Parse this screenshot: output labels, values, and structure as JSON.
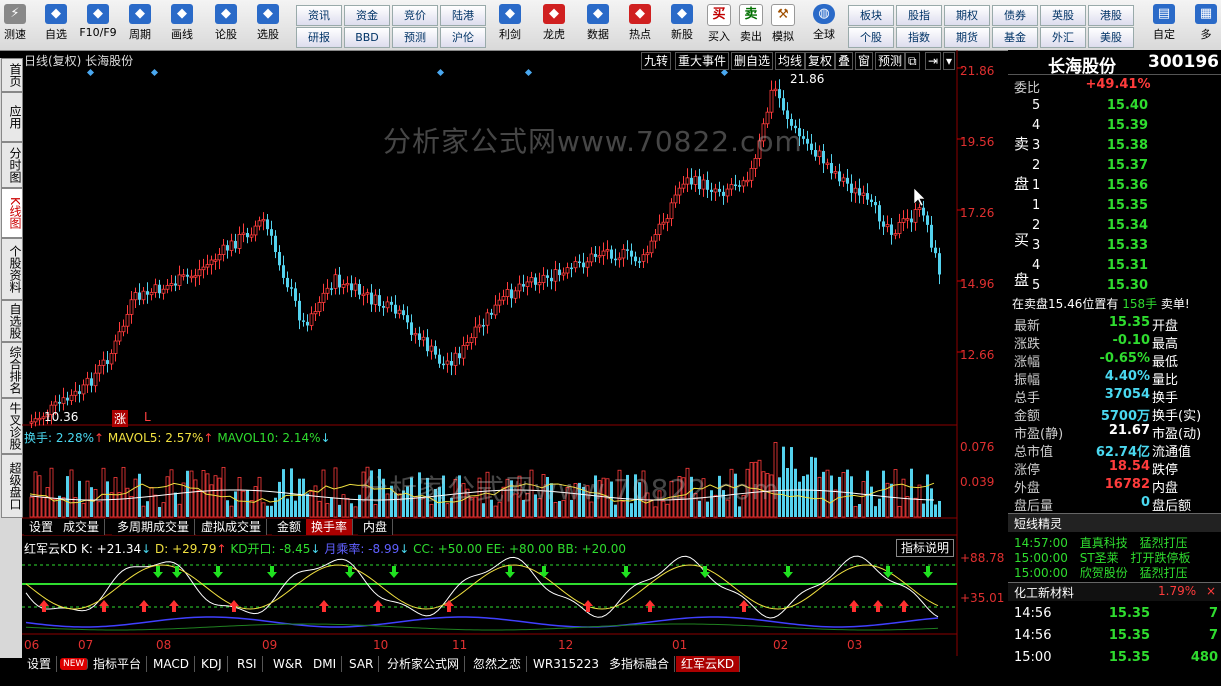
{
  "toolbar": {
    "left_label": "测速",
    "items": [
      {
        "label": "自选",
        "icon": "star-icon",
        "color": "#2a6ac8"
      },
      {
        "label": "F10/F9",
        "icon": "document-icon",
        "color": "#2a6ac8"
      },
      {
        "label": "周期",
        "icon": "clock-icon",
        "color": "#2a6ac8"
      },
      {
        "label": "画线",
        "icon": "pen-icon",
        "color": "#2a6ac8"
      },
      {
        "label": "论股",
        "icon": "forum-icon",
        "color": "#2a6ac8"
      },
      {
        "label": "选股",
        "icon": "speedometer-icon",
        "color": "#2a6ac8"
      }
    ],
    "grid1": [
      [
        "资讯",
        "研报"
      ],
      [
        "资金",
        "BBD"
      ],
      [
        "竞价",
        "预测"
      ],
      [
        "陆港",
        "沪伦"
      ]
    ],
    "items2": [
      {
        "label": "利剑",
        "icon": "chart-icon",
        "color": "#2a6ac8"
      },
      {
        "label": "龙虎",
        "icon": "dragon-icon",
        "color": "#d02020"
      },
      {
        "label": "数据",
        "icon": "pe-icon",
        "color": "#2a6ac8"
      },
      {
        "label": "热点",
        "icon": "fire-icon",
        "color": "#d02020"
      },
      {
        "label": "新股",
        "icon": "ipo-icon",
        "color": "#2a6ac8"
      }
    ],
    "trade": [
      {
        "label": "买入",
        "glyph": "买",
        "color": "#c00000"
      },
      {
        "label": "卖出",
        "glyph": "卖",
        "color": "#007000"
      },
      {
        "label": "模拟",
        "glyph": "⚒",
        "color": "#a05000"
      }
    ],
    "globe_label": "全球",
    "grid2": [
      [
        "板块",
        "个股"
      ],
      [
        "股指",
        "指数"
      ],
      [
        "期权",
        "期货"
      ],
      [
        "债券",
        "基金"
      ],
      [
        "英股",
        "外汇"
      ],
      [
        "港股",
        "美股"
      ]
    ],
    "custom_label": "自定",
    "more_label": "多"
  },
  "lefttabs": [
    "首页",
    "应用",
    "分时图",
    "K线图",
    "个股资料",
    "自选股",
    "综合排名",
    "牛叉诊股",
    "超级盘口"
  ],
  "chart": {
    "header_left": "日线(复权)  长海股份",
    "top_buttons": [
      "九转",
      "重大事件",
      "删自选",
      "均线",
      "复权",
      "叠",
      "窗",
      "预测"
    ],
    "watermark": "分析家公式网www.70822.com",
    "price_ticks": [
      "21.86",
      "19.56",
      "17.26",
      "14.96",
      "12.66"
    ],
    "high_label": "21.86",
    "low_label": "10.36",
    "zhang_label": "涨",
    "l_label": "L",
    "vol_header": {
      "hs": "换手: 2.28%",
      "mv5": "MAVOL5: 2.57%",
      "mv10": "MAVOL10: 2.14%"
    },
    "vol_ticks": [
      "0.076",
      "0.039"
    ],
    "mid_tabs": [
      "设置",
      "成交量",
      "多周期成交量",
      "虚拟成交量",
      "金额",
      "换手率",
      "内盘"
    ],
    "kd_header": {
      "name": "红军云KD",
      "k": "K: +21.34",
      "d": "D: +29.79",
      "kdo": "KD开口: -8.45",
      "yjl": "月乘率: -8.99",
      "cc": "CC: +50.00",
      "ee": "EE: +80.00",
      "bb": "BB: +20.00"
    },
    "kd_button": "指标说明",
    "kd_ticks": [
      "+88.78",
      "+35.01"
    ],
    "months": [
      "06",
      "07",
      "08",
      "09",
      "10",
      "11",
      "12",
      "01",
      "02",
      "03"
    ],
    "bottom_tabs": [
      "设置",
      "NEW",
      "指标平台",
      "MACD",
      "KDJ",
      "RSI",
      "W&R",
      "DMI",
      "SAR",
      "分析家公式网",
      "忽然之恋",
      "WR315223",
      "多指标融合",
      "红军云KD"
    ]
  },
  "right": {
    "name": "长海股份",
    "code": "300196",
    "wb_label": "委比",
    "wb_value": "+49.41%",
    "sell_label": [
      "卖",
      "盘"
    ],
    "buy_label": [
      "买",
      "盘"
    ],
    "sell": [
      {
        "n": "5",
        "p": "15.40"
      },
      {
        "n": "4",
        "p": "15.39"
      },
      {
        "n": "3",
        "p": "15.38"
      },
      {
        "n": "2",
        "p": "15.37"
      },
      {
        "n": "1",
        "p": "15.36"
      }
    ],
    "buy": [
      {
        "n": "1",
        "p": "15.35"
      },
      {
        "n": "2",
        "p": "15.34"
      },
      {
        "n": "3",
        "p": "15.33"
      },
      {
        "n": "4",
        "p": "15.31"
      },
      {
        "n": "5",
        "p": "15.30"
      }
    ],
    "notice": {
      "text": "在卖盘15.46位置有",
      "qty": "158手",
      "tail": "卖单!"
    },
    "stats": [
      {
        "l": "最新",
        "v": "15.35",
        "c": "green",
        "r": "开盘"
      },
      {
        "l": "涨跌",
        "v": "-0.10",
        "c": "green",
        "r": "最高"
      },
      {
        "l": "涨幅",
        "v": "-0.65%",
        "c": "green",
        "r": "最低"
      },
      {
        "l": "振幅",
        "v": "4.40%",
        "c": "cyan",
        "r": "量比"
      },
      {
        "l": "总手",
        "v": "37054",
        "c": "cyan",
        "r": "换手"
      },
      {
        "l": "金额",
        "v": "5700万",
        "c": "cyan",
        "r": "换手(实)"
      },
      {
        "l": "市盈(静)",
        "v": "21.67",
        "c": "white",
        "r": "市盈(动)"
      },
      {
        "l": "总市值",
        "v": "62.74亿",
        "c": "cyan",
        "r": "流通值"
      },
      {
        "l": "涨停",
        "v": "18.54",
        "c": "red",
        "r": "跌停"
      },
      {
        "l": "外盘",
        "v": "16782",
        "c": "red",
        "r": "内盘"
      },
      {
        "l": "盘后量",
        "v": "0",
        "c": "cyan",
        "r": "盘后额"
      }
    ],
    "short_title": "短线精灵",
    "short": [
      {
        "t": "14:57:00",
        "s": "直真科技",
        "e": "猛烈打压"
      },
      {
        "t": "15:00:00",
        "s": "ST圣莱",
        "e": "打开跌停板"
      },
      {
        "t": "15:00:00",
        "s": "欣贺股份",
        "e": "猛烈打压"
      }
    ],
    "sector": {
      "name": "化工新材料",
      "pct": "1.79%"
    },
    "ticks": [
      {
        "t": "14:56",
        "p": "15.35",
        "v": "7"
      },
      {
        "t": "14:56",
        "p": "15.35",
        "v": "7"
      },
      {
        "t": "15:00",
        "p": "15.35",
        "v": "480"
      }
    ]
  }
}
